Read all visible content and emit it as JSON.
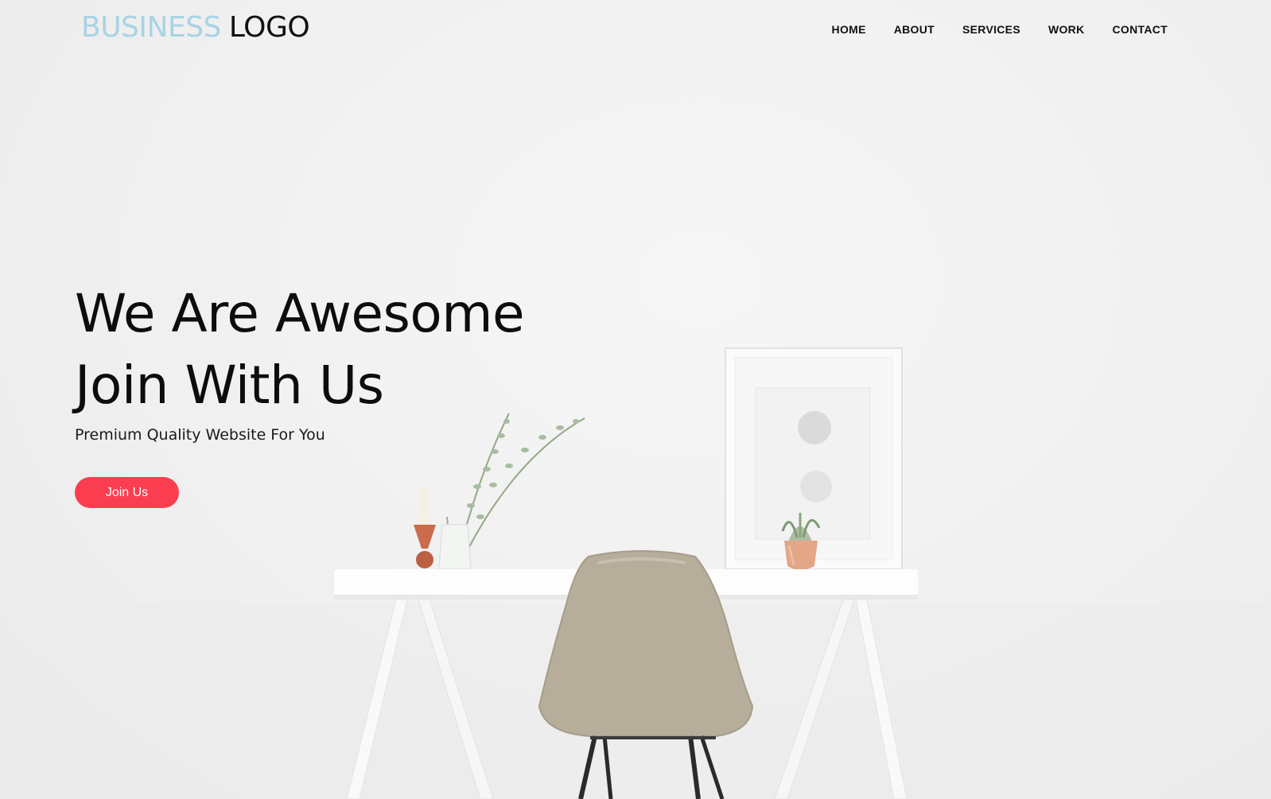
{
  "brand": {
    "logo_primary": "BUSINESS",
    "logo_secondary": "LOGO",
    "primary_color": "#a8d3e4",
    "accent_color": "#fa3e50"
  },
  "nav": {
    "items": [
      {
        "label": "HOME"
      },
      {
        "label": "ABOUT"
      },
      {
        "label": "SERVICES"
      },
      {
        "label": "WORK"
      },
      {
        "label": "CONTACT"
      }
    ]
  },
  "hero": {
    "headline_line1": "We Are Awesome",
    "headline_line2": "Join With Us",
    "subheadline": "Premium Quality Website For You",
    "cta_label": "Join Us"
  }
}
